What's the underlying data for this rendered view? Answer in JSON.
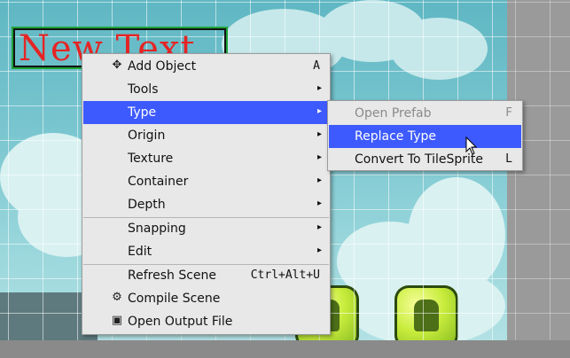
{
  "scene": {
    "text_object": "New Text"
  },
  "context_menu": {
    "items": [
      {
        "label": "Add Object",
        "shortcut": "A",
        "icon": "plus-icon"
      },
      {
        "label": "Tools",
        "submenu": true
      },
      {
        "label": "Type",
        "submenu": true,
        "active": true
      },
      {
        "label": "Origin",
        "submenu": true
      },
      {
        "label": "Texture",
        "submenu": true
      },
      {
        "label": "Container",
        "submenu": true
      },
      {
        "label": "Depth",
        "submenu": true
      },
      {
        "label": "Snapping",
        "submenu": true
      },
      {
        "label": "Edit",
        "submenu": true
      },
      {
        "label": "Refresh Scene",
        "shortcut": "Ctrl+Alt+U"
      },
      {
        "label": "Compile Scene",
        "icon": "gear-icon"
      },
      {
        "label": "Open Output File",
        "icon": "file-icon"
      }
    ],
    "submenu_arrow": "▸"
  },
  "type_submenu": {
    "items": [
      {
        "label": "Open Prefab",
        "shortcut": "F",
        "disabled": true
      },
      {
        "label": "Replace Type",
        "active": true
      },
      {
        "label": "Convert To TileSprite",
        "shortcut": "L"
      }
    ]
  },
  "colors": {
    "highlight": "#3d5afe",
    "text_object": "#e52525",
    "selection_border": "#1fa33a"
  }
}
